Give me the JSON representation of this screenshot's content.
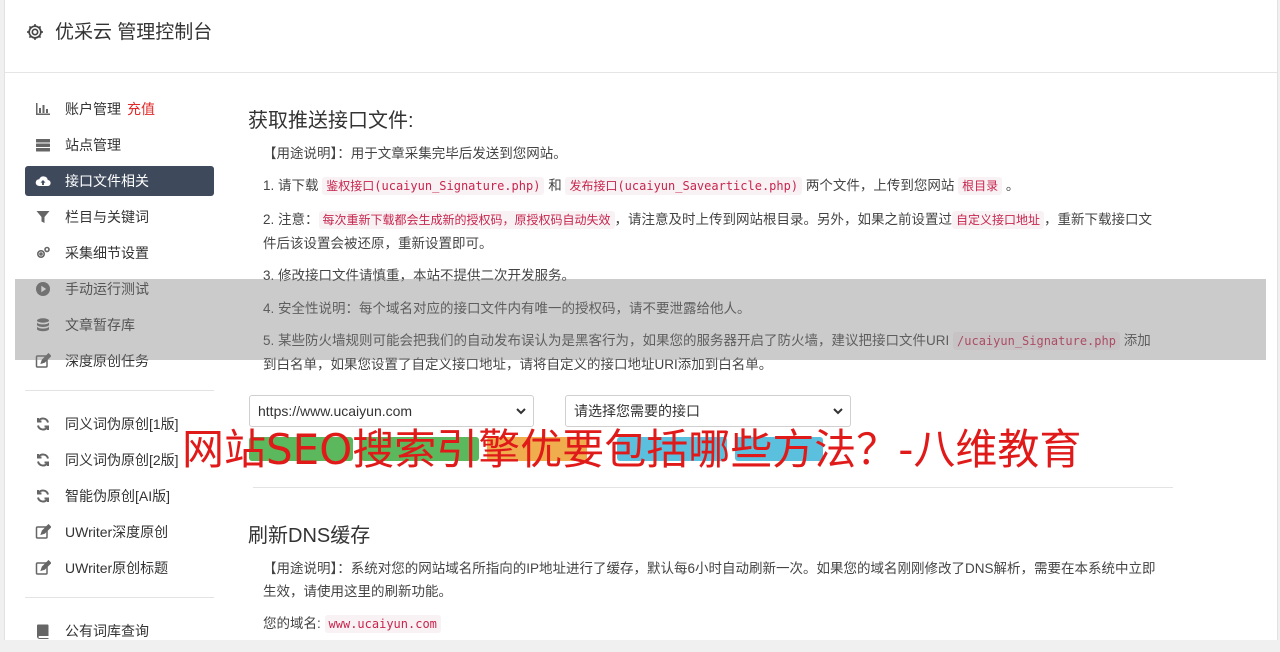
{
  "header": {
    "title": "优采云 管理控制台"
  },
  "sidebar": {
    "items": [
      {
        "label": "账户管理",
        "badge": "充值",
        "icon": "bar-chart-icon"
      },
      {
        "label": "站点管理",
        "icon": "server-icon"
      },
      {
        "label": "接口文件相关",
        "icon": "cloud-upload-icon",
        "active": true
      },
      {
        "label": "栏目与关键词",
        "icon": "filter-icon"
      },
      {
        "label": "采集细节设置",
        "icon": "cogs-icon"
      },
      {
        "label": "手动运行测试",
        "icon": "play-icon"
      },
      {
        "label": "文章暂存库",
        "icon": "database-icon"
      },
      {
        "label": "深度原创任务",
        "icon": "edit-icon"
      }
    ],
    "items2": [
      {
        "label": "同义词伪原创[1版]",
        "icon": "refresh-icon"
      },
      {
        "label": "同义词伪原创[2版]",
        "icon": "refresh-icon"
      },
      {
        "label": "智能伪原创[AI版]",
        "icon": "refresh-icon"
      },
      {
        "label": "UWriter深度原创",
        "icon": "edit-icon"
      },
      {
        "label": "UWriter原创标题",
        "icon": "edit-icon"
      }
    ],
    "items3": [
      {
        "label": "公有词库查询",
        "icon": "book-icon"
      }
    ]
  },
  "main": {
    "section1": {
      "title": "获取推送接口文件:",
      "usage": "【用途说明】：用于文章采集完毕后发送到您网站。",
      "p1": {
        "a": "1. 请下载 ",
        "code1": "鉴权接口(ucaiyun_Signature.php)",
        "b": " 和 ",
        "code2": "发布接口(ucaiyun_Savearticle.php)",
        "c": " 两个文件，上传到您网站 ",
        "code3": "根目录",
        "d": " 。"
      },
      "p2": {
        "a": "2. 注意：",
        "code1": "每次重新下载都会生成新的授权码，原授权码自动失效",
        "b": "，请注意及时上传到网站根目录。另外，如果之前设置过",
        "code2": "自定义接口地址",
        "c": "，重新下载接口文件后该设置会被还原，重新设置即可。"
      },
      "p3": "3. 修改接口文件请慎重，本站不提供二次开发服务。",
      "p4": "4. 安全性说明：每个域名对应的接口文件内有唯一的授权码，请不要泄露给他人。",
      "p5": {
        "a": "5. 某些防火墙规则可能会把我们的自动发布误认为是黑客行为，如果您的服务器开启了防火墙，建议把接口文件URI ",
        "code1": "/ucaiyun_Signature.php",
        "b": " 添加到白名单，如果您设置了自定义接口地址，请将自定义的接口地址URI添加到白名单。"
      },
      "select_site": "https://www.ucaiyun.com",
      "select_api": "请选择您需要的接口"
    },
    "section2": {
      "title": "刷新DNS缓存",
      "usage": "【用途说明】：系统对您的网站域名所指向的IP地址进行了缓存，默认每6小时自动刷新一次。如果您的域名刚刚修改了DNS解析，需要在本系统中立即生效，请使用这里的刷新功能。",
      "domain_label": "您的域名:",
      "domain_value": "www.ucaiyun.com"
    }
  },
  "watermark": "网站SEO搜索引擎优要包括哪些方法？-八维教育",
  "colors": {
    "sidebar_active": "#3e4a5c",
    "recharge": "#e02a2a",
    "code": "#c7254e",
    "watermark": "#e01919"
  }
}
